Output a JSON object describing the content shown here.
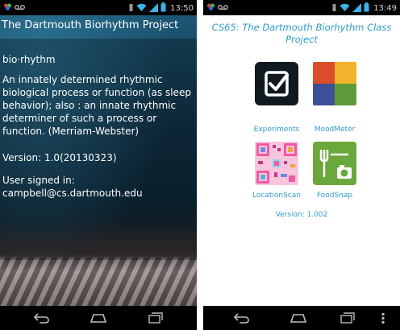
{
  "left_screen": {
    "status": {
      "time": "13:50"
    },
    "title": "The Dartmouth Biorhythm Project",
    "term": "bio·rhythm",
    "definition": "An innately determined rhythmic biological process or function (as sleep behavior); also : an innate rhythmic determiner of such a process or function. (Merriam-Webster)",
    "version": "Version: 1.0(20130323)",
    "signed_in_label": "User signed in:",
    "user_email": "campbell@cs.dartmouth.edu"
  },
  "right_screen": {
    "status": {
      "time": "13:49"
    },
    "title_line1": "CS65: The Dartmouth Biorhythm Class",
    "title_line2": "Project",
    "apps": [
      {
        "label": "Experiments",
        "icon": "check-tablet-icon"
      },
      {
        "label": "MoodMeter",
        "icon": "mood-grid-icon"
      },
      {
        "label": "LocationScan",
        "icon": "qr-code-icon"
      },
      {
        "label": "FoodSnap",
        "icon": "camera-food-icon"
      }
    ],
    "version": "Version: 1.002"
  },
  "colors": {
    "accent_blue": "#2f9bc8",
    "status_bar": "#000000",
    "nav_bar": "#000000",
    "mood_red": "#d94d2b",
    "mood_yellow": "#f0b32a",
    "mood_blue": "#3e4f9a",
    "mood_green": "#5e9a3a",
    "foodsnap_green": "#6aa83c",
    "qr_pink": "#ee5aa6"
  }
}
